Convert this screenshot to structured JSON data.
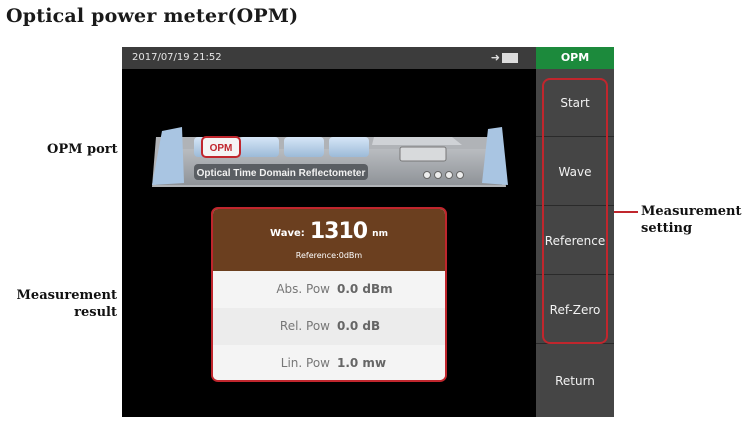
{
  "page": {
    "title": "Optical power meter(OPM)"
  },
  "annotations": {
    "opm_port": "OPM port",
    "measurement_result_1": "Measurement",
    "measurement_result_2": "result",
    "measurement_setting_1": "Measurement",
    "measurement_setting_2": "setting"
  },
  "status": {
    "datetime": "2017/07/19  21:52"
  },
  "device": {
    "port_label": "OPM",
    "name": "Optical Time Domain Reflectometer"
  },
  "menu": {
    "title": "OPM",
    "items": [
      {
        "label": "Start"
      },
      {
        "label": "Wave"
      },
      {
        "label": "Reference"
      },
      {
        "label": "Ref-Zero"
      },
      {
        "label": "Return"
      }
    ]
  },
  "result": {
    "wave_label": "Wave:",
    "wave_value": "1310",
    "wave_unit": "nm",
    "reference": "Reference:0dBm",
    "rows": [
      {
        "label": "Abs. Pow",
        "value": "0.0 dBm"
      },
      {
        "label": "Rel. Pow",
        "value": "0.0 dB"
      },
      {
        "label": "Lin. Pow",
        "value": "1.0 mw"
      }
    ]
  },
  "colors": {
    "accent": "#c0262d",
    "header_green": "#1c8a3c",
    "result_head": "#6b3f1f"
  }
}
